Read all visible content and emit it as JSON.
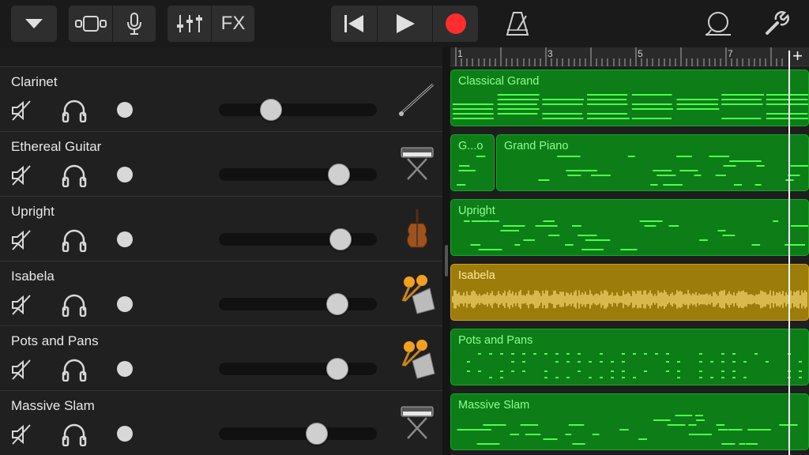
{
  "toolbar": {
    "fx_label": "FX",
    "icons": [
      "chevron-down-icon",
      "view-toggle-icon",
      "microphone-icon",
      "mixer-sliders-icon",
      "rewind-icon",
      "play-icon",
      "record-icon",
      "metronome-icon",
      "loop-icon",
      "settings-wrench-icon"
    ],
    "record_color": "#ff2d2d"
  },
  "ruler": {
    "bars": [
      "1",
      "3",
      "5",
      "7"
    ],
    "add_label": "+"
  },
  "tracks": [
    {
      "name": "Clarinet",
      "volume": 0.33,
      "instrument_icon": "clarinet-icon"
    },
    {
      "name": "Ethereal Guitar",
      "volume": 0.76,
      "instrument_icon": "keyboard-icon"
    },
    {
      "name": "Upright",
      "volume": 0.77,
      "instrument_icon": "upright-bass-icon"
    },
    {
      "name": "Isabela",
      "volume": 0.75,
      "instrument_icon": "percussion-icon"
    },
    {
      "name": "Pots and Pans",
      "volume": 0.75,
      "instrument_icon": "percussion-icon"
    },
    {
      "name": "Massive Slam",
      "volume": 0.62,
      "instrument_icon": "keyboard-icon"
    }
  ],
  "regions": [
    [
      {
        "name": "Classical Grand",
        "kind": "midi"
      }
    ],
    [
      {
        "name": "G...o",
        "kind": "midi"
      },
      {
        "name": "Grand Piano",
        "kind": "midi"
      }
    ],
    [
      {
        "name": "Upright",
        "kind": "midi"
      }
    ],
    [
      {
        "name": "Isabela",
        "kind": "audio"
      }
    ],
    [
      {
        "name": "Pots and Pans",
        "kind": "midi"
      }
    ],
    [
      {
        "name": "Massive Slam",
        "kind": "midi"
      }
    ]
  ],
  "colors": {
    "midi_region": "#0d7d18",
    "audio_region": "#9c7c0a",
    "note": "#4dff4d",
    "waveform": "#ffe27a"
  }
}
